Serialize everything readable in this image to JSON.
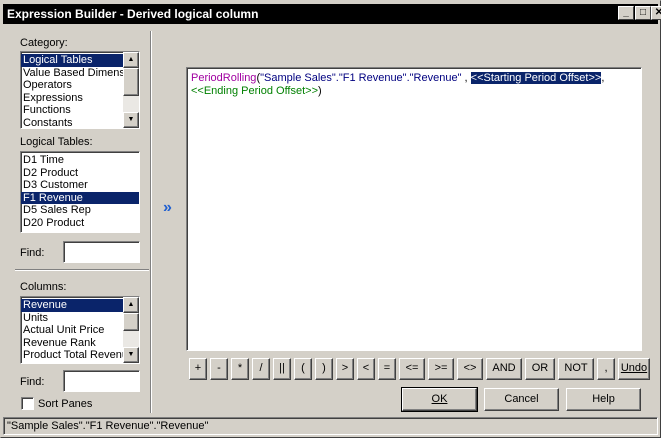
{
  "window": {
    "title": "Expression Builder - Derived logical column",
    "buttons": {
      "minimize": "_",
      "maximize": "□",
      "close": "✕"
    }
  },
  "category": {
    "label": "Category:",
    "items": [
      "Logical Tables",
      "Value Based Dimensions",
      "Operators",
      "Expressions",
      "Functions",
      "Constants"
    ],
    "selected": "Logical Tables"
  },
  "logical_tables": {
    "label": "Logical Tables:",
    "items": [
      "D1 Time",
      "D2 Product",
      "D3 Customer",
      "F1 Revenue",
      "D5 Sales Rep",
      "D20 Product"
    ],
    "selected": "F1 Revenue",
    "find_label": "Find:",
    "find_value": ""
  },
  "columns": {
    "label": "Columns:",
    "items": [
      "Revenue",
      "Units",
      "Actual Unit Price",
      "Revenue Rank",
      "Product Total Revenue"
    ],
    "selected": "Revenue",
    "find_label": "Find:",
    "find_value": ""
  },
  "sort_panes": {
    "label": "Sort Panes",
    "checked": false
  },
  "insert_arrow": "»",
  "expression": {
    "function": "PeriodRolling",
    "open": "(",
    "arg1": "\"Sample Sales\".\"F1 Revenue\".\"Revenue\"",
    "sep1": " , ",
    "arg2": "<<Starting Period Offset>>",
    "sep2": ",",
    "arg3": "<<Ending Period Offset>>",
    "close": ")"
  },
  "operators": [
    "+",
    "-",
    "*",
    "/",
    "||",
    "(",
    ")",
    ">",
    "<",
    "=",
    "<=",
    ">=",
    "<>",
    "AND",
    "OR",
    "NOT",
    ",",
    "Undo"
  ],
  "actions": {
    "ok": "OK",
    "cancel": "Cancel",
    "help": "Help"
  },
  "status": "\"Sample Sales\".\"F1 Revenue\".\"Revenue\""
}
